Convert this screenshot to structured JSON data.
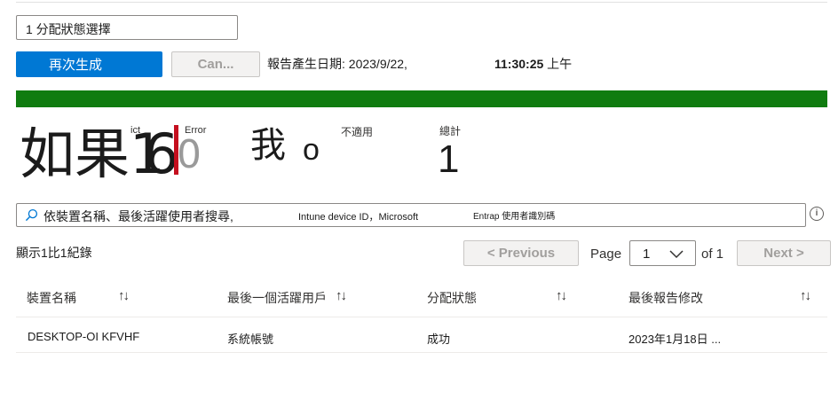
{
  "filter": {
    "selected": "1 分配狀態選擇"
  },
  "toolbar": {
    "regenerate_label": "再次生成",
    "cancel_label": "Can...",
    "report_date_label": "報告產生日期: 2023/9/22,",
    "report_time": "11:30:25",
    "report_ampm": "上午"
  },
  "summary": {
    "big_text": "如果1",
    "big_num_overlap": "6",
    "big_num_ghost": "0",
    "label_conflict": "ict",
    "label_error": "Error",
    "error_value": "0",
    "char_wo": "我",
    "wo_value": "o",
    "label_not_applicable": "不適用",
    "label_total": "總計",
    "total_value": "1"
  },
  "search": {
    "placeholder_main": "依裝置名稱、最後活躍使用者搜尋,",
    "placeholder_mid": "Intune device ID，Microsoft",
    "placeholder_end": "Entrap 使用者識別碼"
  },
  "list": {
    "count_text": "顯示1比1紀錄"
  },
  "pagination": {
    "previous_label": "< Previous",
    "page_label": "Page",
    "page_value": "1",
    "of_label": "of 1",
    "next_label": "Next >"
  },
  "table": {
    "headers": [
      "裝置名稱",
      "最後一個活躍用戶",
      "分配狀態",
      "最後報告修改"
    ],
    "sort_glyph": "↑↓",
    "rows": [
      [
        "DESKTOP-OI KFVHF",
        "系統帳號",
        "成功",
        "2023年1月18日 ..."
      ]
    ]
  },
  "colors": {
    "primary": "#0078d4",
    "success_bar": "#107c10",
    "error_bar": "#c50f1f"
  }
}
